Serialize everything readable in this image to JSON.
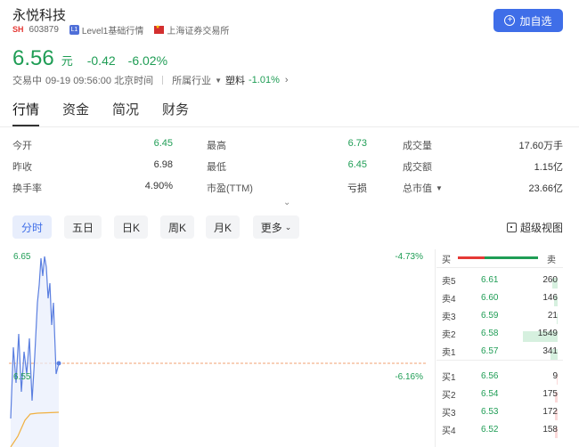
{
  "header": {
    "name": "永悦科技",
    "market": "SH",
    "code": "603879",
    "quote_level": "Level1基础行情",
    "exchange": "上海证券交易所",
    "add_label": "加自选"
  },
  "quote": {
    "price": "6.56",
    "unit": "元",
    "change": "-0.42",
    "change_pct": "-6.02%",
    "status": "交易中",
    "time": "09-19 09:56:00 北京时间",
    "industry_label": "所属行业",
    "industry_name": "塑料",
    "industry_change": "-1.01%"
  },
  "tabs": [
    "行情",
    "资金",
    "简况",
    "财务"
  ],
  "stats": {
    "c1": [
      {
        "label": "今开",
        "value": "6.45",
        "color": "green"
      },
      {
        "label": "昨收",
        "value": "6.98",
        "color": "dark"
      },
      {
        "label": "换手率",
        "value": "4.90%",
        "color": "dark"
      }
    ],
    "c2": [
      {
        "label": "最高",
        "value": "6.73",
        "color": "green"
      },
      {
        "label": "最低",
        "value": "6.45",
        "color": "green"
      },
      {
        "label": "市盈(TTM)",
        "value": "亏损",
        "color": "dark"
      }
    ],
    "c3": [
      {
        "label": "成交量",
        "value": "17.60万手"
      },
      {
        "label": "成交额",
        "value": "1.15亿"
      },
      {
        "label": "总市值",
        "value": "23.66亿"
      }
    ]
  },
  "periods": [
    "分时",
    "五日",
    "日K",
    "周K",
    "月K",
    "更多"
  ],
  "super_view_label": "超级视图",
  "chart": {
    "top_price": "6.65",
    "top_pct": "-4.73%",
    "ref_price": "6.55",
    "ref_pct": "-6.16%"
  },
  "orderbook": {
    "buy_label": "买",
    "sell_label": "卖",
    "asks": [
      {
        "label": "卖5",
        "price": "6.61",
        "vol": "260",
        "bar": 0.14
      },
      {
        "label": "卖4",
        "price": "6.60",
        "vol": "146",
        "bar": 0.08
      },
      {
        "label": "卖3",
        "price": "6.59",
        "vol": "21",
        "bar": 0.02
      },
      {
        "label": "卖2",
        "price": "6.58",
        "vol": "1549",
        "bar": 0.85
      },
      {
        "label": "卖1",
        "price": "6.57",
        "vol": "341",
        "bar": 0.18
      }
    ],
    "bids": [
      {
        "label": "买1",
        "price": "6.56",
        "vol": "9",
        "bar": 0.02
      },
      {
        "label": "买2",
        "price": "6.54",
        "vol": "175",
        "bar": 0.06
      },
      {
        "label": "买3",
        "price": "6.53",
        "vol": "172",
        "bar": 0.06
      },
      {
        "label": "买4",
        "price": "6.52",
        "vol": "158",
        "bar": 0.06
      }
    ]
  }
}
